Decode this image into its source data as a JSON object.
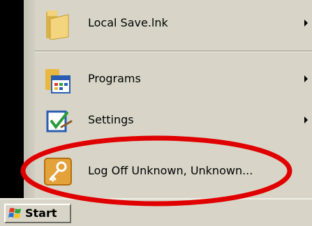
{
  "start_menu": {
    "items": [
      {
        "label": "Local Save.lnk",
        "icon": "folder-icon",
        "has_submenu": true
      },
      {
        "label": "Programs",
        "icon": "programs-icon",
        "has_submenu": true
      },
      {
        "label": "Settings",
        "icon": "settings-icon",
        "has_submenu": true
      },
      {
        "label": "Log Off Unknown, Unknown...",
        "icon": "log-off-key-icon",
        "has_submenu": false
      }
    ]
  },
  "taskbar": {
    "start_label": "Start",
    "start_icon": "windows-flag-icon"
  },
  "annotation": {
    "shape": "ellipse",
    "color": "#e00000",
    "target": "log-off-menu-item"
  },
  "colors": {
    "menu_background": "#d8d5c8",
    "left_strip": "#000000"
  }
}
